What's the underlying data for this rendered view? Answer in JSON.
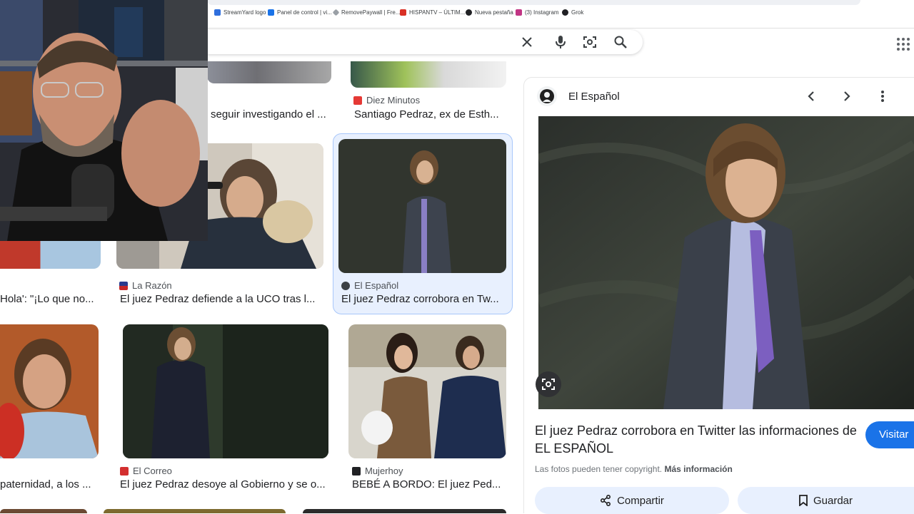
{
  "bookmarks": [
    {
      "label": "StreamYard logo",
      "color": "#2f6fdd"
    },
    {
      "label": "Panel de control | vi...",
      "color": "#1a73e8"
    },
    {
      "label": "RemovePaywall | Fre...",
      "color": "#5f6368"
    },
    {
      "label": "HISPANTV – ÚLTIM...",
      "color": "#d93025"
    },
    {
      "label": "Nueva pestaña",
      "color": "#202124"
    },
    {
      "label": "(3) Instagram",
      "color": "#c13584"
    },
    {
      "label": "Grok",
      "color": "#202124"
    }
  ],
  "search": {
    "value": "",
    "clear_icon": "✕",
    "mic_icon": "mic-icon",
    "lens_icon": "camera-lens-icon",
    "search_icon": "search-icon"
  },
  "grid": {
    "row1": [
      {
        "source": "",
        "caption": "seguir investigando el ..."
      },
      {
        "source": "Diez Minutos",
        "caption": "Santiago Pedraz, ex de Esth..."
      }
    ],
    "row2": [
      {
        "source": "",
        "caption": "Hola': \"¡Lo que no..."
      },
      {
        "source": "La Razón",
        "caption": "El juez Pedraz defiende a la UCO tras l..."
      },
      {
        "source": "El Español",
        "caption": "El juez Pedraz corrobora en Tw..."
      }
    ],
    "row3": [
      {
        "source": "",
        "caption": "paternidad, a los ..."
      },
      {
        "source": "El Correo",
        "caption": "El juez Pedraz desoye al Gobierno y se o..."
      },
      {
        "source": "Mujerhoy",
        "caption": "BEBÉ A BORDO: El juez Ped..."
      }
    ]
  },
  "panel": {
    "source": "El Español",
    "title": "El juez Pedraz corrobora en Twitter las informaciones de EL ESPAÑOL",
    "visit_label": "Visitar",
    "copyright_text": "Las fotos pueden tener copyright.",
    "more_info_label": "Más información",
    "share_label": "Compartir",
    "save_label": "Guardar"
  },
  "colors": {
    "accent": "#1a73e8",
    "selected_bg": "#e8f0fe",
    "selected_border": "#a8c7fa"
  }
}
